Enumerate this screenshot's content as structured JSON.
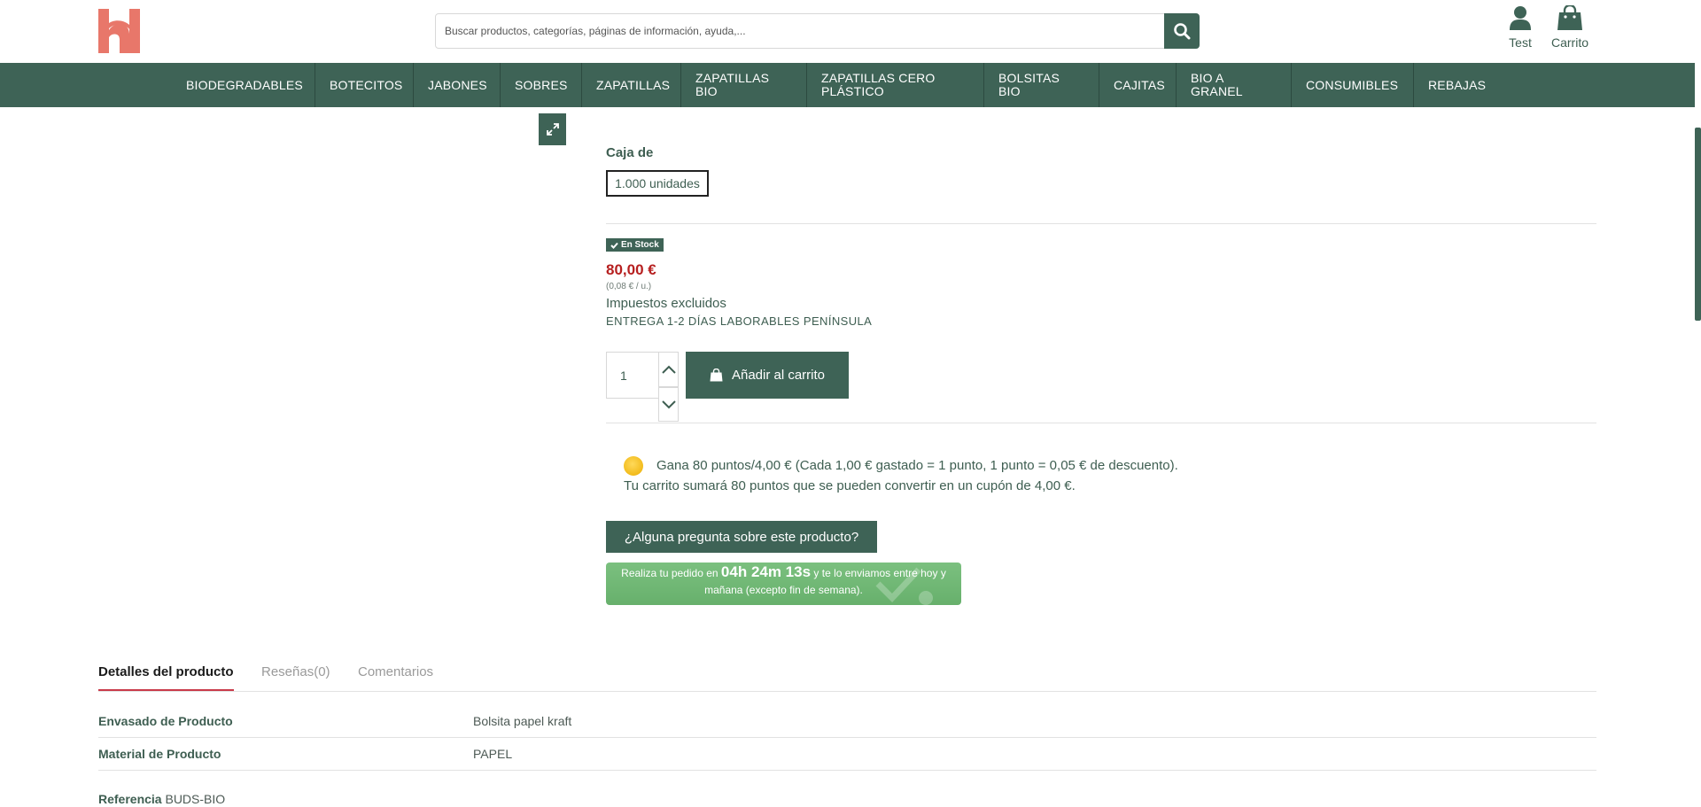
{
  "colors": {
    "brand_green": "#3e6356",
    "logo_coral": "#e8776a",
    "price_red": "#b61f1f",
    "tab_accent": "#c93a4a"
  },
  "header": {
    "logo_icon": "store-logo-h",
    "search": {
      "placeholder": "Buscar productos, categorías, páginas de información, ayuda,...",
      "button_icon": "search-icon"
    },
    "account_label": "Test",
    "cart_label": "Carrito"
  },
  "nav": {
    "items": [
      {
        "label": "BIODEGRADABLES"
      },
      {
        "label": "BOTECITOS"
      },
      {
        "label": "JABONES"
      },
      {
        "label": "SOBRES"
      },
      {
        "label": "ZAPATILLAS"
      },
      {
        "label": "ZAPATILLAS BIO"
      },
      {
        "label": "ZAPATILLAS CERO PLÁSTICO"
      },
      {
        "label": "BOLSITAS BIO"
      },
      {
        "label": "CAJITAS"
      },
      {
        "label": "BIO A GRANEL"
      },
      {
        "label": "CONSUMIBLES"
      },
      {
        "label": "REBAJAS"
      }
    ]
  },
  "product": {
    "variant_label": "Caja de",
    "variant_value": "1.000 unidades",
    "stock_label": "En Stock",
    "price": "80,00 €",
    "unit_price": "(0,08 € / u.)",
    "tax_note": "Impuestos excluidos",
    "delivery_note": "ENTREGA 1-2 DÍAS LABORABLES PENÍNSULA",
    "quantity": "1",
    "add_to_cart_label": "Añadir al carrito",
    "points_line1": "Gana 80 puntos/4,00 € (Cada 1,00 € gastado = 1 punto, 1 punto = 0,05 € de descuento).",
    "points_line2": "Tu carrito sumará 80 puntos que se pueden convertir en un cupón de 4,00 €.",
    "question_label": "¿Alguna pregunta sobre este producto?",
    "order_banner": {
      "prefix": "Realiza tu pedido en",
      "countdown": "04h 24m 13s",
      "suffix": "y te lo enviamos entre hoy y",
      "line2": "mañana (excepto fin de semana)."
    }
  },
  "tabs": [
    {
      "label": "Detalles del producto",
      "active": true
    },
    {
      "label": "Reseñas(0)",
      "active": false
    },
    {
      "label": "Comentarios",
      "active": false
    }
  ],
  "details": [
    {
      "label": "Envasado de Producto",
      "value": "Bolsita papel kraft"
    },
    {
      "label": "Material de Producto",
      "value": "PAPEL"
    }
  ],
  "reference": {
    "label": "Referencia",
    "value": "BUDS-BIO"
  }
}
